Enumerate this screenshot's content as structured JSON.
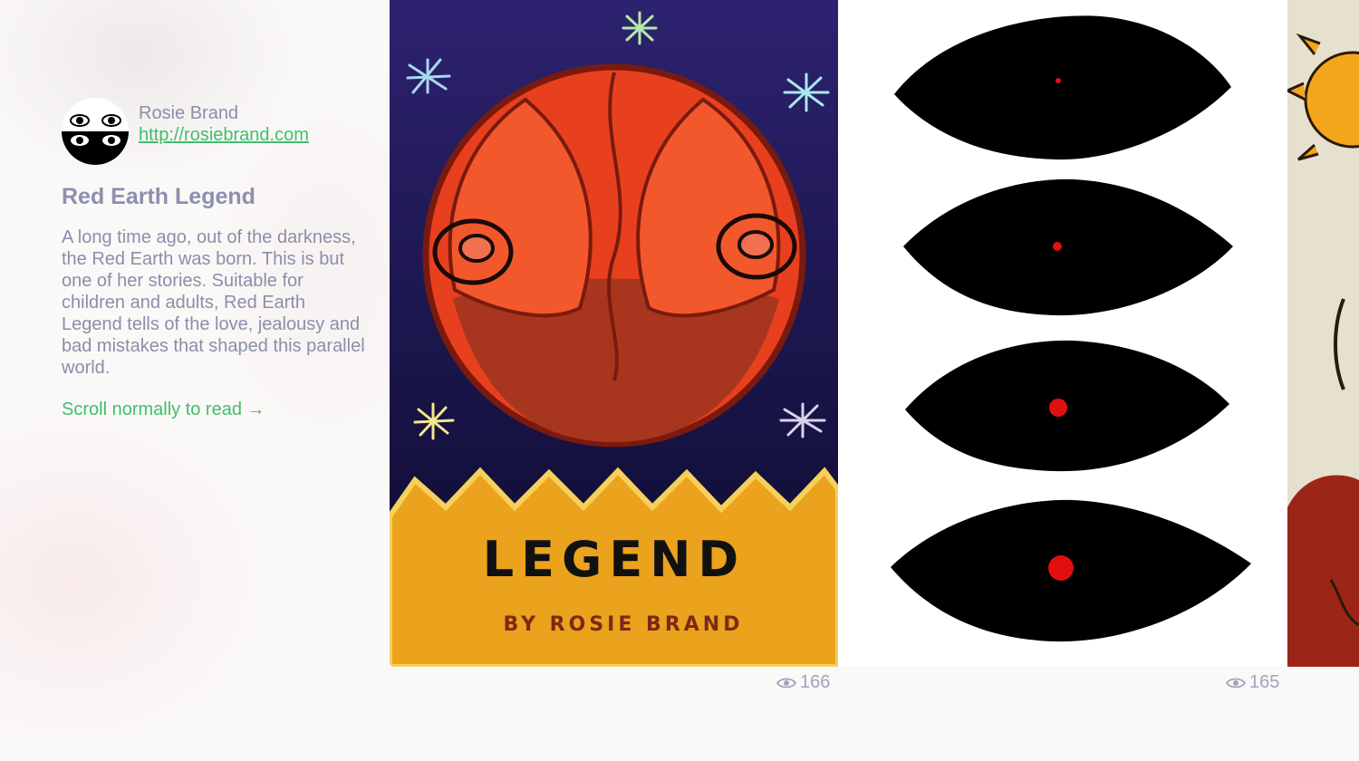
{
  "author": {
    "name": "Rosie Brand",
    "url": "http://rosiebrand.com"
  },
  "story": {
    "title": "Red Earth Legend",
    "description": "A long time ago, out of the darkness, the Red Earth was born. This is but one of her stories. Suitable for children and adults, Red Earth Legend tells of the love, jealousy and bad mistakes that shaped this parallel world.",
    "cta": "Scroll normally to read →"
  },
  "pages": [
    {
      "cover_title": "LEGEND",
      "cover_byline": "BY ROSIE BRAND",
      "views": "166"
    },
    {
      "views": "165"
    },
    {}
  ],
  "icons": {
    "views": "eye-icon"
  },
  "colors": {
    "accent": "#3fbf6a",
    "text": "#8a8fa8",
    "cover_sky": "#1c1650",
    "cover_planet": "#e8401e",
    "cover_ground": "#eba21c"
  }
}
